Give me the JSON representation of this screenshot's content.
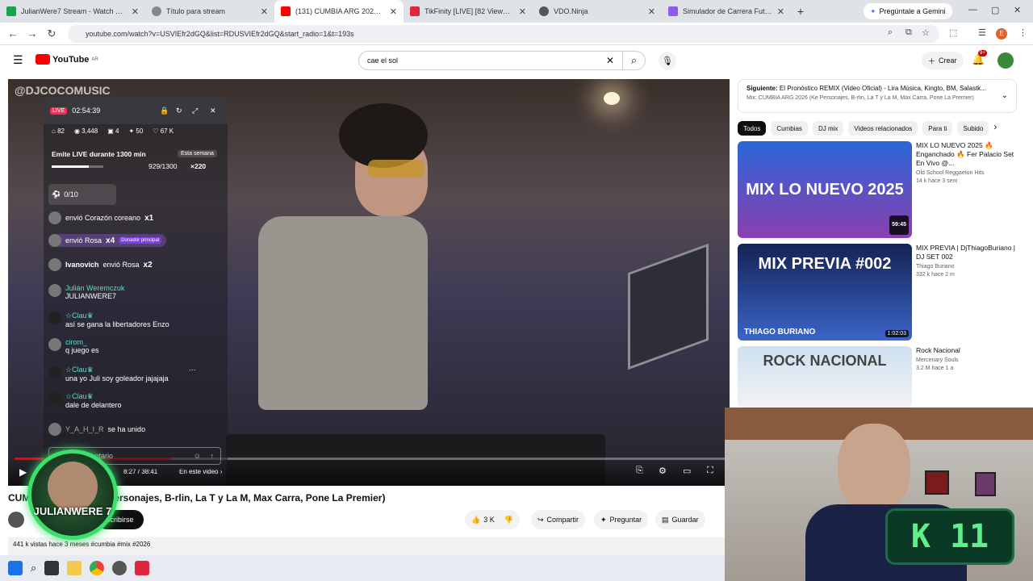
{
  "browser": {
    "tabs": [
      {
        "title": "JulianWere7 Stream - Watch Li...",
        "fav_color": "#1aa34a"
      },
      {
        "title": "Título para stream",
        "fav_color": "#888888"
      },
      {
        "title": "(131) CUMBIA ARG 2026 (Ke Pe...",
        "fav_color": "#ff0000",
        "active": true
      },
      {
        "title": "TikFinity [LIVE] [82 Viewers]",
        "fav_color": "#e0263d"
      },
      {
        "title": "VDO.Ninja",
        "fav_color": "#555555"
      },
      {
        "title": "Simulador de Carrera Futbolísti...",
        "fav_color": "#8c5cf0"
      }
    ],
    "gemini_label": "Pregúntale a Gemini",
    "url": "youtube.com/watch?v=USVIEfr2dGQ&list=RDUSVIEfr2dGQ&start_radio=1&t=193s"
  },
  "youtube": {
    "search_value": "cae el sol",
    "create_label": "Crear",
    "notif_count": "9+",
    "logo_text": "YouTube",
    "logo_sup": "AR"
  },
  "overlay": {
    "live_label": "LIVE",
    "live_time": "02:54:39",
    "stats": [
      "82",
      "3,448",
      "4",
      "50",
      "67 K"
    ],
    "channel_watermark": "@DJCOCOMUSIC",
    "goal_text": "Emite LIVE durante 1300 min",
    "goal_period": "Esta semana",
    "goal_progress": "929/1300",
    "goal_fraction": 0.715,
    "goal_reward": "×220",
    "match_label": "0/10",
    "chat": [
      {
        "user": "",
        "text": "envió Corazón coreano",
        "mult": "x1"
      },
      {
        "user": "",
        "text": "envió Rosa",
        "mult": "x4",
        "tag": "Donador principal"
      },
      {
        "user": "Ivanovich",
        "text": "envió Rosa",
        "mult": "x2"
      },
      {
        "user": "Julián Weremczuk",
        "text": "JULIANWERE7"
      },
      {
        "user": "☆Clau♛",
        "text": "así se gana la libertadores Enzo"
      },
      {
        "user": "cirom_",
        "text": "q juego es"
      },
      {
        "user": "☆Clau♛",
        "text": "una yo Juli soy goleador jajajaja"
      },
      {
        "user": "☆Clau♛",
        "text": "dale de delantero"
      },
      {
        "user": "Y_A_H_I_R",
        "text": "se ha unido"
      }
    ],
    "comment_placeholder": "Añadir comentario"
  },
  "player": {
    "time": "8:27 / 38:41",
    "in_video": "En este video",
    "progress_fraction": 0.22
  },
  "video": {
    "title": "CUM... ersonajes, B-rlin, La T y La M, Max Carra, Pone La Premier)",
    "title_prefix": "CUM",
    "title_rest": "ersonajes, B-rlin, La T y La M, Max Carra, Pone La Premier)",
    "subscribe": "scribirse",
    "likes": "3 K",
    "share": "Compartir",
    "ask": "Preguntar",
    "save": "Guardar",
    "views": "441 k vistas  hace 3 meses  #cumbia #mix #2026"
  },
  "sidebar": {
    "next_label": "Siguiente:",
    "next_title": "El Pronóstico REMIX (Video Oficial) - Lira Música, Kingto, BM, Salastk...",
    "next_sub": "Mix: CUMBIA ARG 2026 (Ke Personajes, B-rlin, La T y La M, Max Carra, Pone La Premier)",
    "chips": [
      "Todos",
      "Cumbias",
      "DJ mix",
      "Videos relacionados",
      "Para ti",
      "Subido"
    ],
    "recs": [
      {
        "title": "MIX LO NUEVO 2025 🔥 Enganchado 🔥 Fer Palacio Set En Vivo @...",
        "channel": "Old School Reggaeton Hits",
        "meta": "14 k  hace 3 sem",
        "duration": "59:45",
        "thumb_text": "MIX LO NUEVO 2025",
        "color": "#3a6dcf"
      },
      {
        "title": "MIX PREVIA | DjThiagoBuriano | DJ SET 002",
        "channel": "Thiago Buriano",
        "meta": "332 k  hace 2 m",
        "duration": "1:02:03",
        "thumb_text": "MIX PREVIA #002",
        "sub_text": "THIAGO BURIANO",
        "color": "#1f2f6b"
      },
      {
        "title": "Rock Nacional",
        "channel": "Mercenary Souls",
        "meta": "3.2 M  hace 1 a",
        "thumb_text": "ROCK NACIONAL",
        "color": "#b9d3ec"
      }
    ]
  },
  "badge": {
    "name": "JULIANWERE 7"
  },
  "counter": {
    "letter": "K",
    "value": "11"
  }
}
